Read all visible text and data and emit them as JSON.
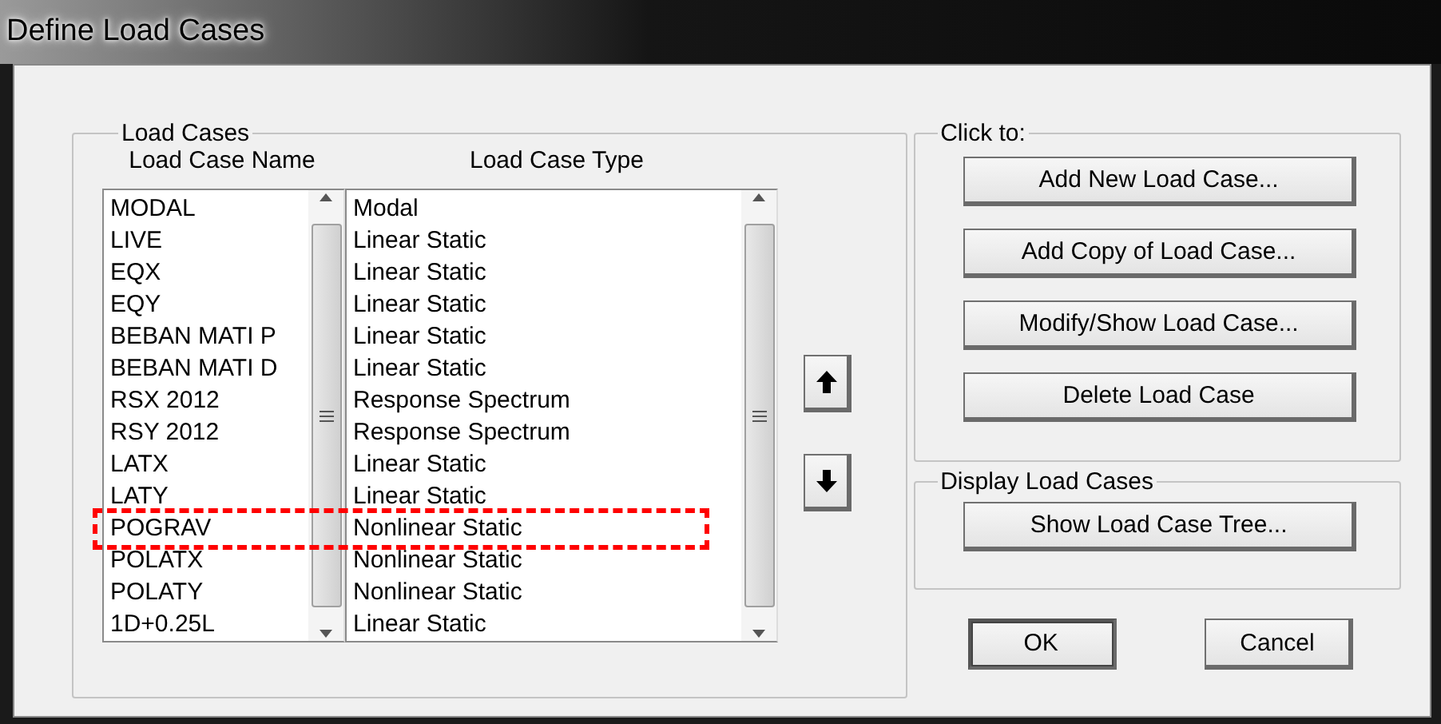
{
  "window": {
    "title": "Define Load Cases"
  },
  "load_cases": {
    "title": "Load Cases",
    "columns": [
      "Load Case Name",
      "Load Case Type"
    ],
    "rows": [
      {
        "name": "MODAL",
        "type": "Modal",
        "highlighted": false
      },
      {
        "name": "LIVE",
        "type": "Linear Static",
        "highlighted": false
      },
      {
        "name": "EQX",
        "type": "Linear Static",
        "highlighted": false
      },
      {
        "name": "EQY",
        "type": "Linear Static",
        "highlighted": false
      },
      {
        "name": "BEBAN MATI P",
        "type": "Linear Static",
        "highlighted": false
      },
      {
        "name": "BEBAN MATI D",
        "type": "Linear Static",
        "highlighted": false
      },
      {
        "name": "RSX 2012",
        "type": "Response Spectrum",
        "highlighted": false
      },
      {
        "name": "RSY 2012",
        "type": "Response Spectrum",
        "highlighted": false
      },
      {
        "name": "LATX",
        "type": "Linear Static",
        "highlighted": false
      },
      {
        "name": "LATY",
        "type": "Linear Static",
        "highlighted": false
      },
      {
        "name": "POGRAV",
        "type": "Nonlinear Static",
        "highlighted": true
      },
      {
        "name": "POLATX",
        "type": "Nonlinear Static",
        "highlighted": false
      },
      {
        "name": "POLATY",
        "type": "Nonlinear Static",
        "highlighted": false
      },
      {
        "name": "1D+0.25L",
        "type": "Linear Static",
        "highlighted": false
      }
    ]
  },
  "click_to": {
    "title": "Click to:",
    "buttons": [
      "Add New Load Case...",
      "Add Copy of Load Case...",
      "Modify/Show Load Case...",
      "Delete Load Case"
    ]
  },
  "display": {
    "title": "Display Load Cases",
    "buttons": [
      "Show Load Case Tree..."
    ]
  },
  "buttons": [
    {
      "label": "OK",
      "default": true
    },
    {
      "label": "Cancel",
      "default": false
    }
  ]
}
